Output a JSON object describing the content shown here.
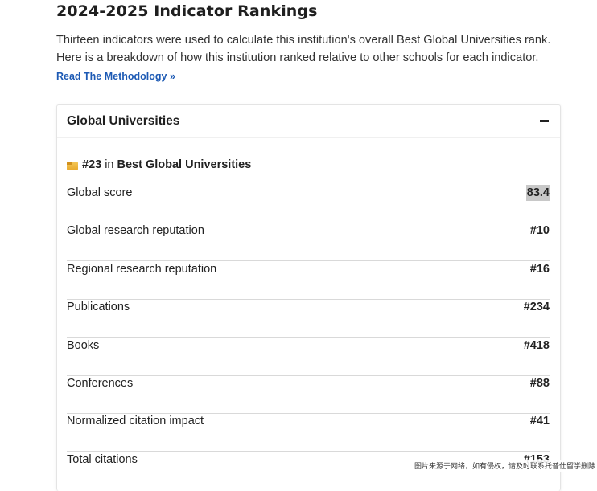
{
  "section": {
    "title": "2024-2025 Indicator Rankings",
    "intro_line1": "Thirteen indicators were used to calculate this institution's overall Best Global Universities rank.",
    "intro_line2": "Here is a breakdown of how this institution ranked relative to other schools for each indicator.",
    "methodology_link": "Read The Methodology »"
  },
  "card": {
    "title": "Global Universities",
    "collapse_icon": "minus-icon",
    "rank": {
      "icon": "medal-icon",
      "number": "#23",
      "in_text": "in",
      "list_name": "Best Global Universities"
    },
    "indicators": [
      {
        "label": "Global score",
        "value": "83.4"
      },
      {
        "label": "Global research reputation",
        "value": "#10"
      },
      {
        "label": "Regional research reputation",
        "value": "#16"
      },
      {
        "label": "Publications",
        "value": "#234"
      },
      {
        "label": "Books",
        "value": "#418"
      },
      {
        "label": "Conferences",
        "value": "#88"
      },
      {
        "label": "Normalized citation impact",
        "value": "#41"
      },
      {
        "label": "Total citations",
        "value": "#153"
      }
    ]
  },
  "watermark": "图片来源于网络，如有侵权，请及时联系托普仕留学删除"
}
